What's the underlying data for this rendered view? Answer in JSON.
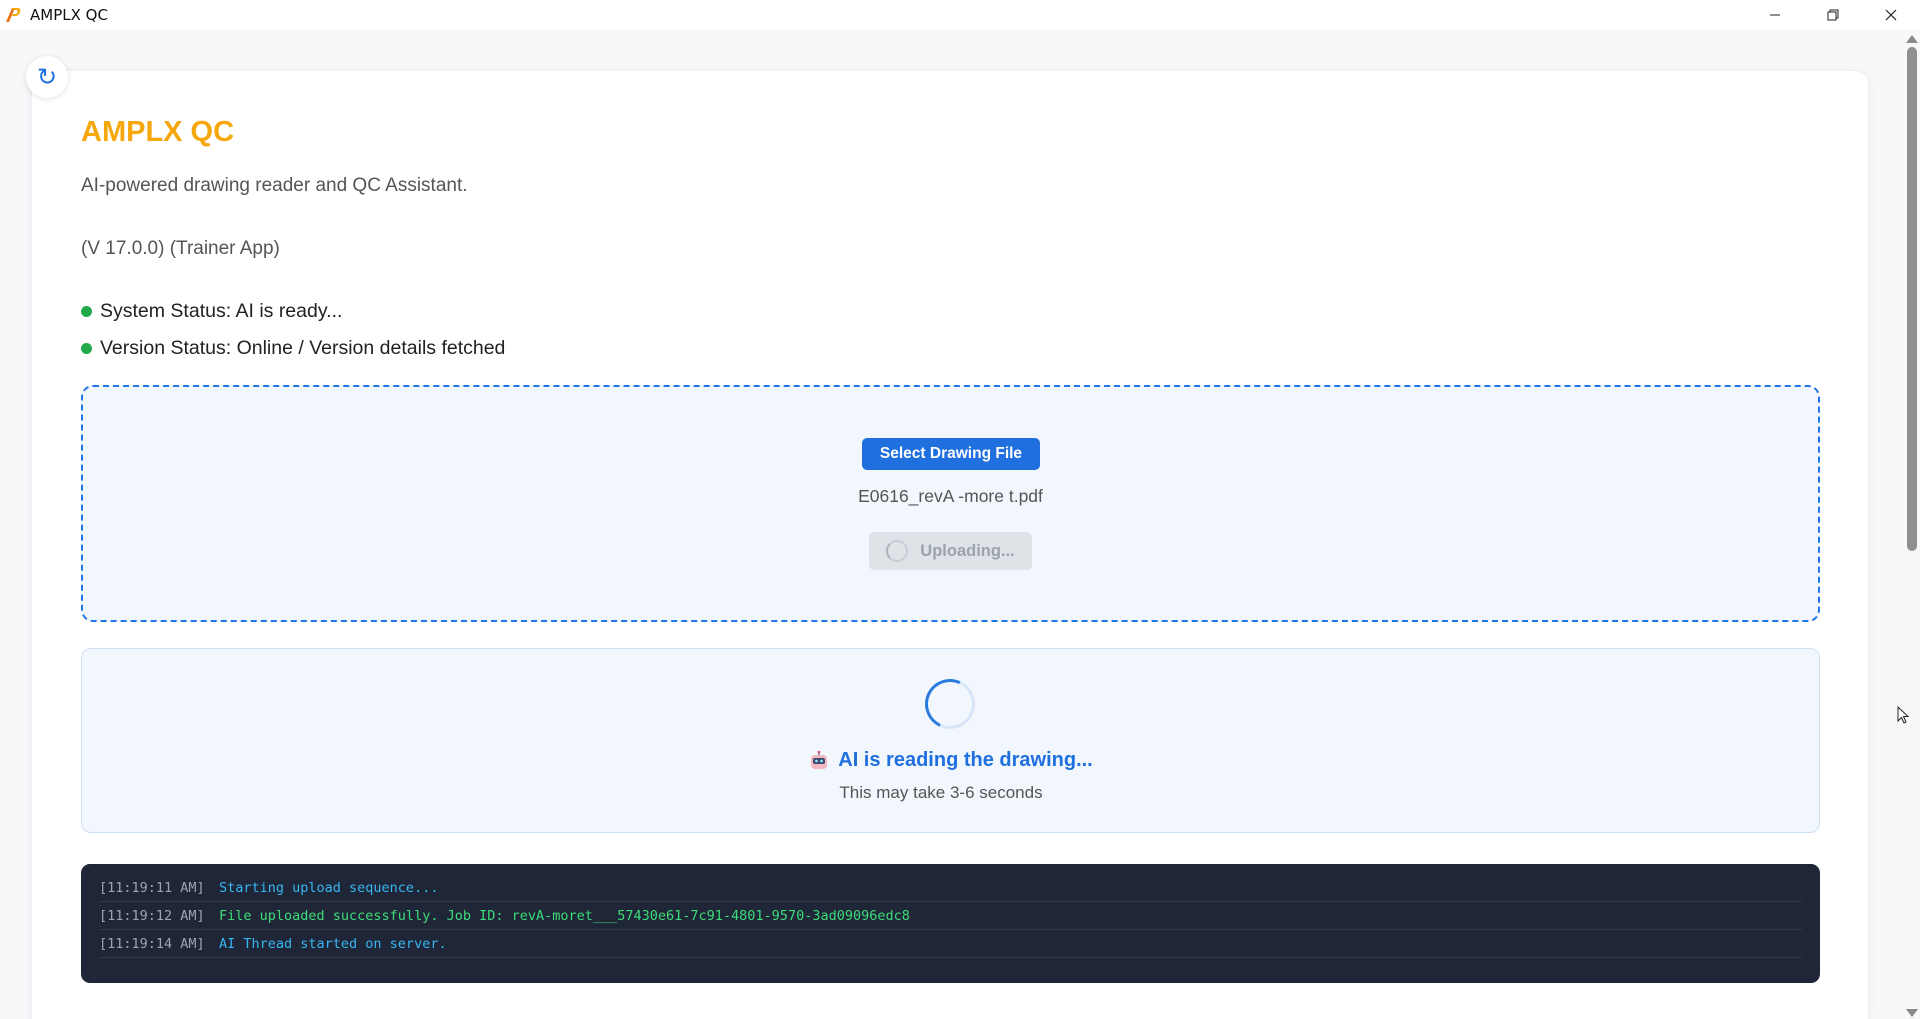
{
  "window": {
    "title": "AMPLX QC"
  },
  "header": {
    "brand": "AMPLX QC",
    "subtitle": "AI-powered drawing reader and QC Assistant.",
    "version": "(V 17.0.0) (Trainer App)"
  },
  "status": [
    {
      "text": "System Status: AI is ready...",
      "color": "#22a94a"
    },
    {
      "text": "Version Status: Online / Version details fetched",
      "color": "#22a94a"
    }
  ],
  "upload": {
    "select_label": "Select Drawing File",
    "file_name": "E0616_revA -more t.pdf",
    "uploading_label": "Uploading..."
  },
  "ai_panel": {
    "message": "AI is reading the drawing...",
    "note": "This may take 3-6 seconds"
  },
  "log": [
    {
      "time": "[11:19:11 AM]",
      "message": "Starting upload sequence...",
      "color": "#38b6f0"
    },
    {
      "time": "[11:19:12 AM]",
      "message": "File uploaded successfully. Job ID: revA-moret___57430e61-7c91-4801-9570-3ad09096edc8",
      "color": "#3ddc7a"
    },
    {
      "time": "[11:19:14 AM]",
      "message": "AI Thread started on server.",
      "color": "#38b6f0"
    }
  ],
  "colors": {
    "brand": "#f5a70b",
    "accent": "#1f6fde",
    "status_ok": "#22a94a",
    "console_bg": "#1f2637"
  },
  "icons": {
    "app": "amplx-logo-icon",
    "refresh": "refresh-icon",
    "robot": "robot-icon"
  }
}
